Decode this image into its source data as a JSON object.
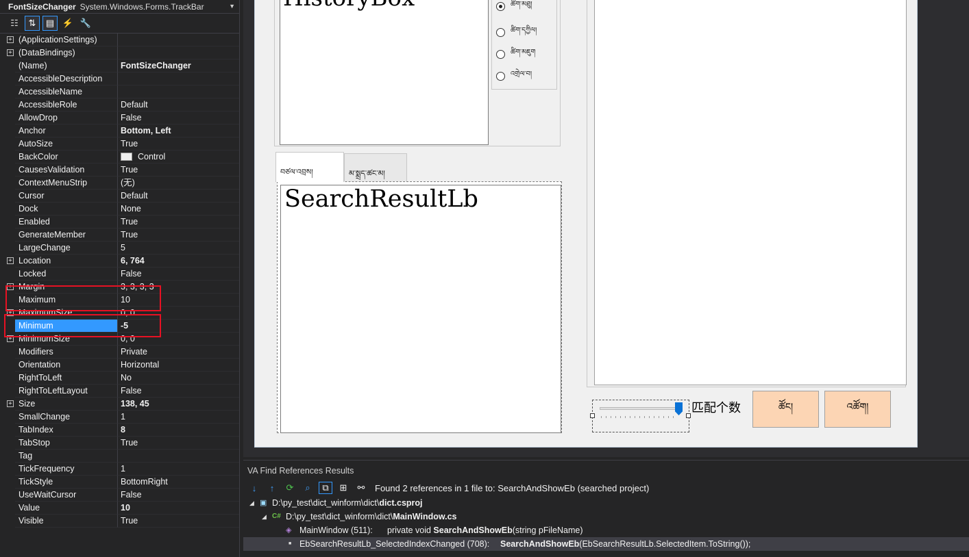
{
  "properties": {
    "object_name": "FontSizeChanger",
    "object_type": "System.Windows.Forms.TrackBar",
    "rows": [
      {
        "name": "(ApplicationSettings)",
        "value": "",
        "expand": true,
        "bold": false
      },
      {
        "name": "(DataBindings)",
        "value": "",
        "expand": true,
        "bold": false
      },
      {
        "name": "(Name)",
        "value": "FontSizeChanger",
        "expand": false,
        "bold": true
      },
      {
        "name": "AccessibleDescription",
        "value": "",
        "expand": false,
        "bold": false
      },
      {
        "name": "AccessibleName",
        "value": "",
        "expand": false,
        "bold": false
      },
      {
        "name": "AccessibleRole",
        "value": "Default",
        "expand": false,
        "bold": false
      },
      {
        "name": "AllowDrop",
        "value": "False",
        "expand": false,
        "bold": false
      },
      {
        "name": "Anchor",
        "value": "Bottom, Left",
        "expand": false,
        "bold": true
      },
      {
        "name": "AutoSize",
        "value": "True",
        "expand": false,
        "bold": false
      },
      {
        "name": "BackColor",
        "value": "Control",
        "expand": false,
        "bold": false,
        "swatch": true
      },
      {
        "name": "CausesValidation",
        "value": "True",
        "expand": false,
        "bold": false
      },
      {
        "name": "ContextMenuStrip",
        "value": "(无)",
        "expand": false,
        "bold": false
      },
      {
        "name": "Cursor",
        "value": "Default",
        "expand": false,
        "bold": false
      },
      {
        "name": "Dock",
        "value": "None",
        "expand": false,
        "bold": false
      },
      {
        "name": "Enabled",
        "value": "True",
        "expand": false,
        "bold": false
      },
      {
        "name": "GenerateMember",
        "value": "True",
        "expand": false,
        "bold": false
      },
      {
        "name": "LargeChange",
        "value": "5",
        "expand": false,
        "bold": false
      },
      {
        "name": "Location",
        "value": "6, 764",
        "expand": true,
        "bold": true
      },
      {
        "name": "Locked",
        "value": "False",
        "expand": false,
        "bold": false
      },
      {
        "name": "Margin",
        "value": "3, 3, 3, 3",
        "expand": true,
        "bold": false
      },
      {
        "name": "Maximum",
        "value": "10",
        "expand": false,
        "bold": false
      },
      {
        "name": "MaximumSize",
        "value": "0, 0",
        "expand": true,
        "bold": false
      },
      {
        "name": "Minimum",
        "value": "-5",
        "expand": false,
        "bold": true,
        "selected": true
      },
      {
        "name": "MinimumSize",
        "value": "0, 0",
        "expand": true,
        "bold": false
      },
      {
        "name": "Modifiers",
        "value": "Private",
        "expand": false,
        "bold": false
      },
      {
        "name": "Orientation",
        "value": "Horizontal",
        "expand": false,
        "bold": false
      },
      {
        "name": "RightToLeft",
        "value": "No",
        "expand": false,
        "bold": false
      },
      {
        "name": "RightToLeftLayout",
        "value": "False",
        "expand": false,
        "bold": false
      },
      {
        "name": "Size",
        "value": "138, 45",
        "expand": true,
        "bold": true
      },
      {
        "name": "SmallChange",
        "value": "1",
        "expand": false,
        "bold": false
      },
      {
        "name": "TabIndex",
        "value": "8",
        "expand": false,
        "bold": true
      },
      {
        "name": "TabStop",
        "value": "True",
        "expand": false,
        "bold": false
      },
      {
        "name": "Tag",
        "value": "",
        "expand": false,
        "bold": false
      },
      {
        "name": "TickFrequency",
        "value": "1",
        "expand": false,
        "bold": false
      },
      {
        "name": "TickStyle",
        "value": "BottomRight",
        "expand": false,
        "bold": false
      },
      {
        "name": "UseWaitCursor",
        "value": "False",
        "expand": false,
        "bold": false
      },
      {
        "name": "Value",
        "value": "10",
        "expand": false,
        "bold": true
      },
      {
        "name": "Visible",
        "value": "True",
        "expand": false,
        "bold": false
      }
    ]
  },
  "designer": {
    "history_box_label": "HistoryBox",
    "radio_options": [
      "ཚིག་མཐུ།",
      "ཚིག་དཀྱིལ།",
      "ཚིག་མཇུག",
      "འགྲེལ་བ།"
    ],
    "tabs": [
      "བཙལ་འབྲས།",
      "མ་སྨྲད་ཚང་མ།"
    ],
    "result_label": "SearchResultLb",
    "match_count_label": "匹配个数",
    "search_button": "ཚོང།",
    "clear_button": "འཚོག།",
    "trackbar_value_fraction": 1.0
  },
  "refs": {
    "title": "VA Find References Results",
    "message": "Found 2 references in 1 file to: SearchAndShowEb (searched project)",
    "project_path_prefix": "D:\\py_test\\dict_winform\\dict\\",
    "project_file": "dict.csproj",
    "file_path_prefix": "D:\\py_test\\dict_winform\\dict\\",
    "file_name": "MainWindow.cs",
    "ref1_location": "MainWindow (511):",
    "ref1_code_pre": "private void ",
    "ref1_code_bold": "SearchAndShowEb",
    "ref1_code_post": "(string pFileName)",
    "ref2_location": "EbSearchResultLb_SelectedIndexChanged (708):",
    "ref2_code_bold": "SearchAndShowEb",
    "ref2_code_post": "(EbSearchResultLb.SelectedItem.ToString());"
  },
  "colors": {
    "selection": "#3399ff",
    "highlight_box": "#e81123",
    "button_peach": "#fcd5b4"
  }
}
